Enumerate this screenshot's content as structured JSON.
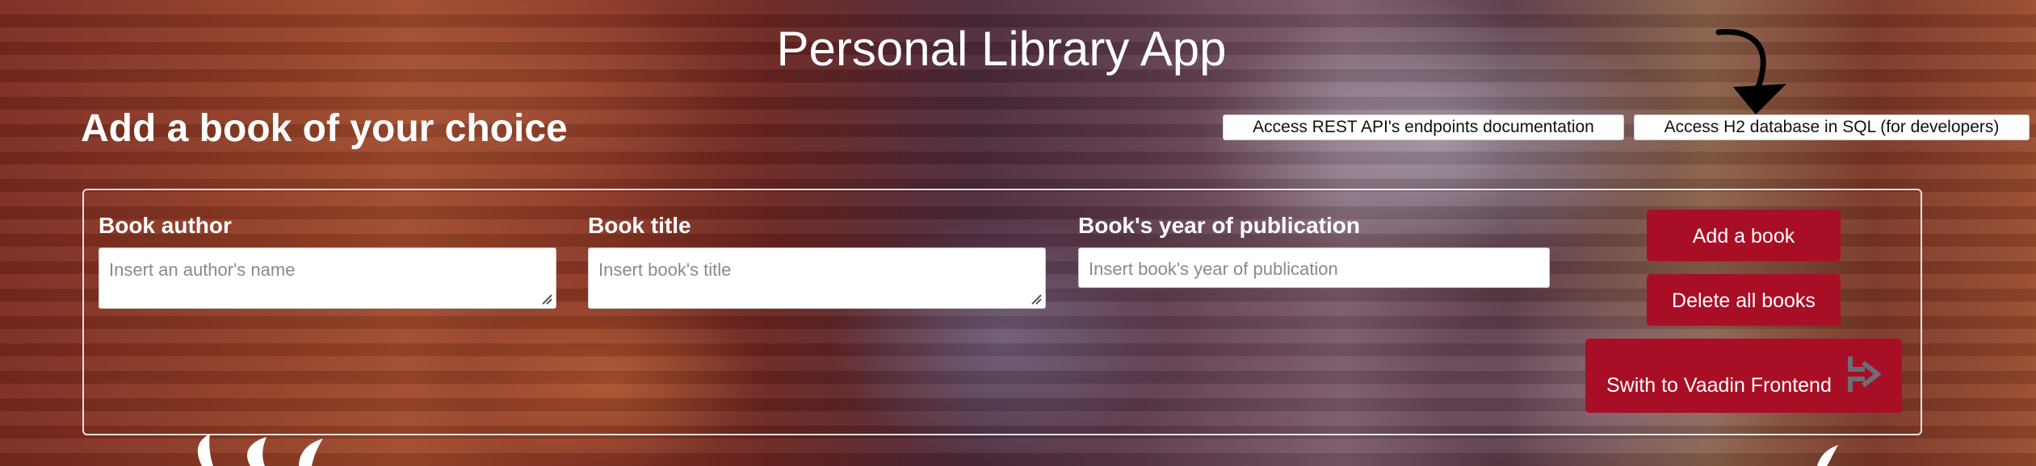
{
  "header": {
    "app_title": "Personal Library App",
    "section_title": "Add a book of your choice"
  },
  "links": {
    "rest_docs": "Access REST API's endpoints documentation",
    "h2_console": "Access H2 database in SQL (for developers)"
  },
  "form": {
    "author": {
      "label": "Book author",
      "placeholder": "Insert an author's name"
    },
    "title": {
      "label": "Book title",
      "placeholder": "Insert book's title"
    },
    "year": {
      "label": "Book's year of publication",
      "placeholder": "Insert book's year of publication"
    }
  },
  "actions": {
    "add": "Add a book",
    "delete_all": "Delete all books",
    "switch_vaadin": "Swith to Vaadin Frontend"
  },
  "icons": {
    "arrow": "curved-arrow-down-icon",
    "vaadin": "vaadin-logo-icon",
    "resize": "resize-grip-icon"
  },
  "colors": {
    "primary_button": "#a80f26",
    "link_button_bg": "#ffffff",
    "text_on_dark": "#ffffff"
  }
}
